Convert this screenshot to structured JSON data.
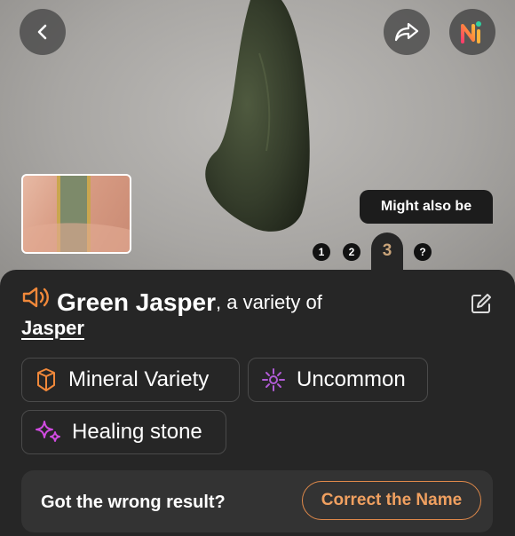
{
  "header": {
    "back_icon": "chevron-left-icon",
    "share_icon": "share-arrow-icon",
    "ai_icon": "ai-logo-icon"
  },
  "gallery": {
    "might_also_be_label": "Might also be",
    "pages": [
      "1",
      "2",
      "3",
      "?"
    ],
    "active_page": "3"
  },
  "result": {
    "name": "Green Jasper",
    "variety_text": ", a variety of",
    "parent": "Jasper",
    "speaker_icon": "speaker-icon",
    "edit_icon": "edit-icon"
  },
  "chips": [
    {
      "label": "Mineral Variety",
      "icon": "crystal-icon",
      "color": "#f0883a"
    },
    {
      "label": "Uncommon",
      "icon": "sparkle-center-icon",
      "color": "#b15bd6"
    },
    {
      "label": "Healing stone",
      "icon": "sparkles-icon",
      "color": "#d04be0"
    }
  ],
  "feedback": {
    "question": "Got the wrong result?",
    "button": "Correct the Name"
  },
  "colors": {
    "accent": "#f0883a",
    "sheet_bg": "#262626",
    "active_page": "#c9a47a"
  }
}
